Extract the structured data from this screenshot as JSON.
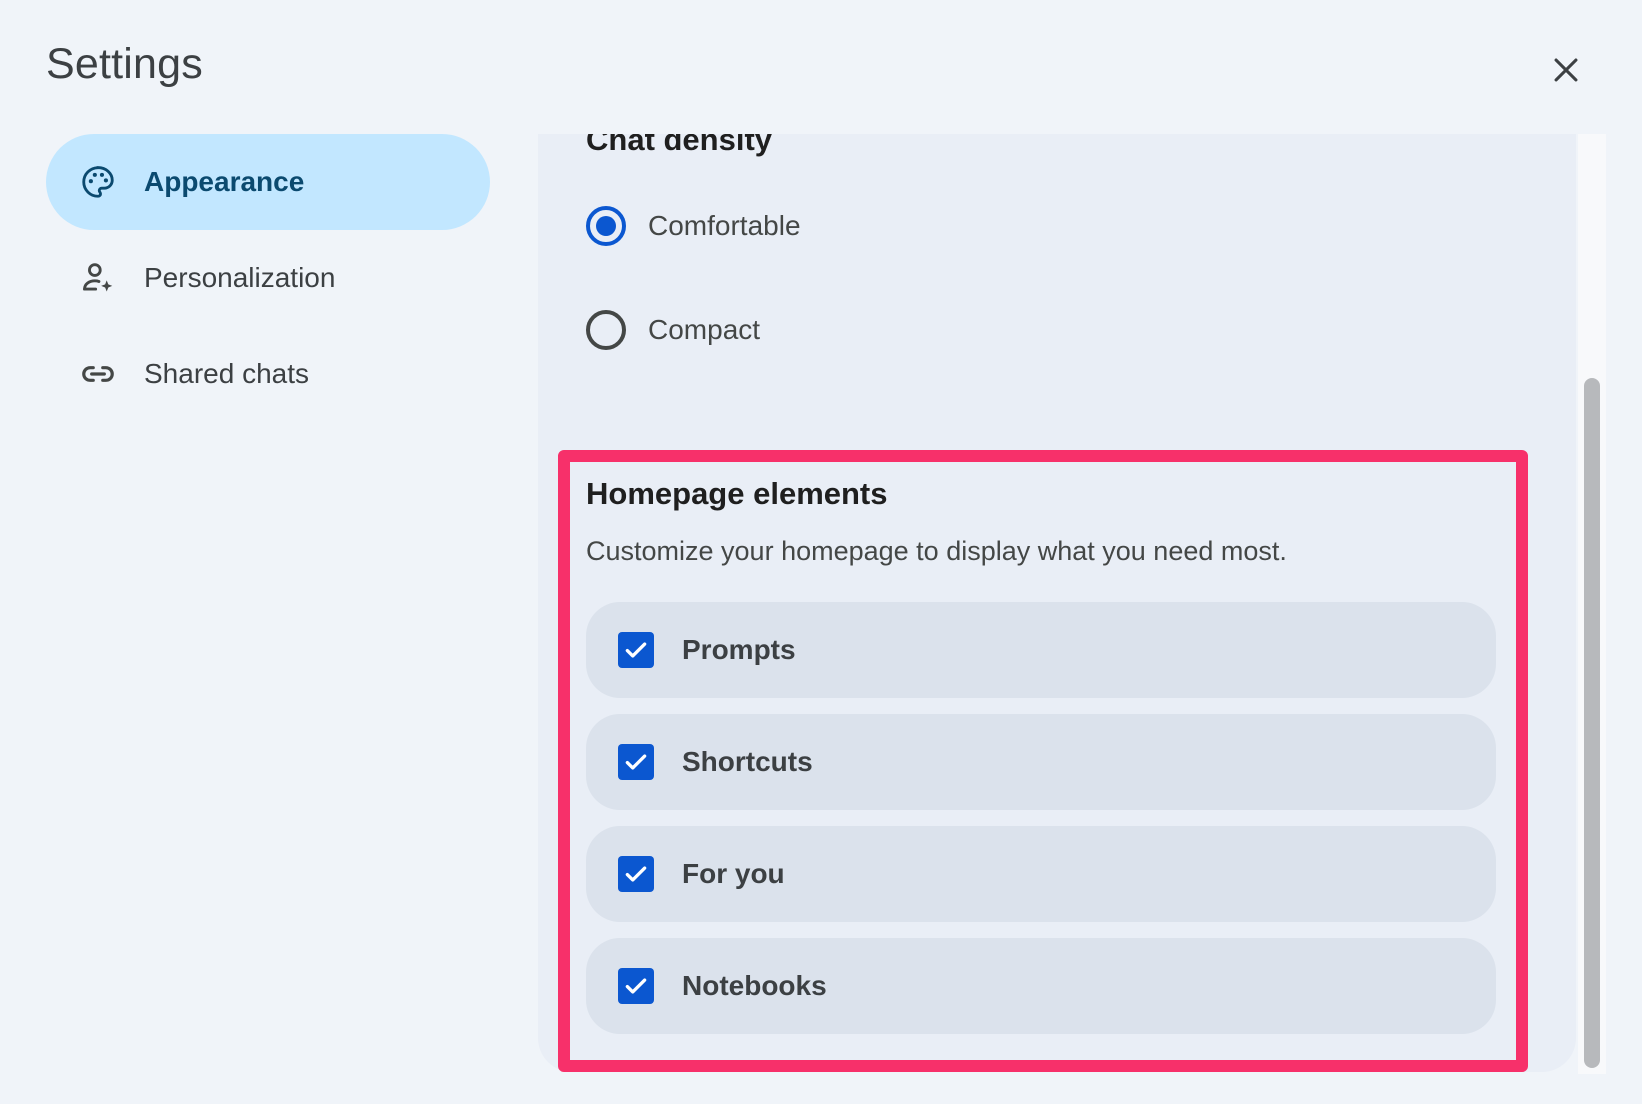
{
  "dialog": {
    "title": "Settings"
  },
  "sidebar": {
    "items": [
      {
        "label": "Appearance",
        "icon": "palette-icon",
        "active": true
      },
      {
        "label": "Personalization",
        "icon": "person-sparkle-icon",
        "active": false
      },
      {
        "label": "Shared chats",
        "icon": "link-icon",
        "active": false
      }
    ]
  },
  "density": {
    "title": "Chat density",
    "options": [
      {
        "label": "Comfortable",
        "selected": true
      },
      {
        "label": "Compact",
        "selected": false
      }
    ]
  },
  "homepage": {
    "title": "Homepage elements",
    "description": "Customize your homepage to display what you need most.",
    "items": [
      {
        "label": "Prompts",
        "checked": true
      },
      {
        "label": "Shortcuts",
        "checked": true
      },
      {
        "label": "For you",
        "checked": true
      },
      {
        "label": "Notebooks",
        "checked": true
      }
    ]
  },
  "colors": {
    "accent": "#0b57d0",
    "active_nav_bg": "#c2e7ff",
    "highlight": "#f7306a"
  }
}
